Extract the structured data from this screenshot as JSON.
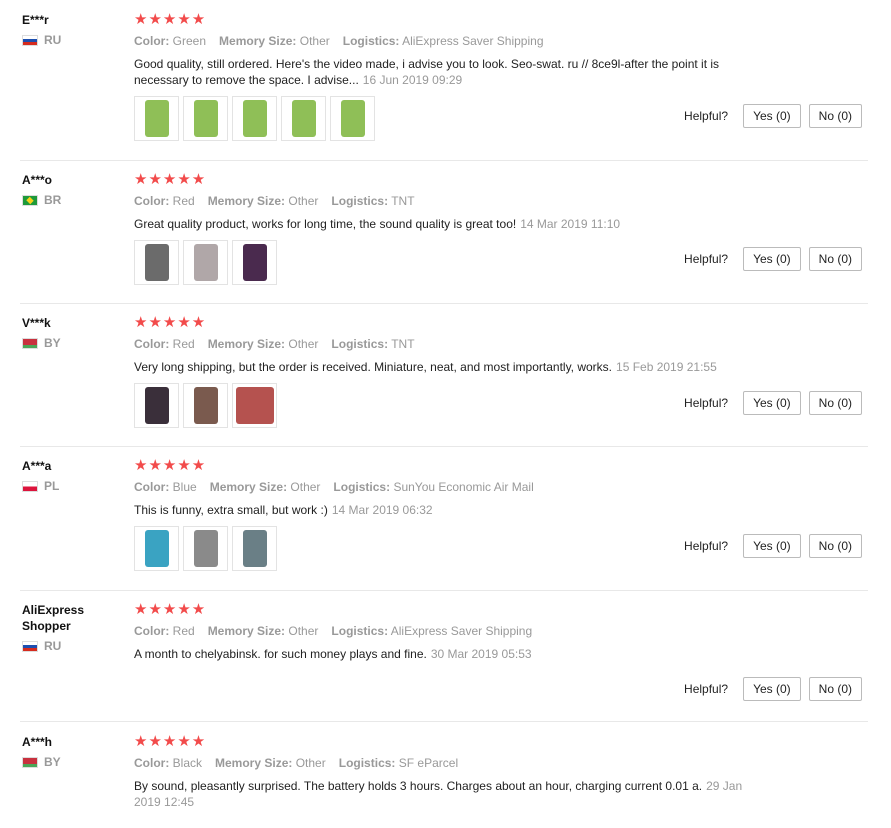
{
  "helpful_label": "Helpful?",
  "star_glyphs": "★★★★★",
  "labels": {
    "color": "Color:",
    "memory": "Memory Size:",
    "logistics": "Logistics:"
  },
  "reviews": [
    {
      "user": "E***r",
      "country": "RU",
      "flag": "ru",
      "rating": 5,
      "color": "Green",
      "memory": "Other",
      "logistics": "AliExpress Saver Shipping",
      "text": "Good quality, still ordered. Here's the video made, i advise you to look. Seo-swat. ru // 8ce9l-after the point it is necessary to remove the space. I advise...",
      "date": "16 Jun 2019 09:29",
      "yes": "Yes (0)",
      "no": "No (0)",
      "photos": [
        "#8fbf57",
        "#8fbf57",
        "#8fbf57",
        "#8fbf57",
        "#8fbf57"
      ]
    },
    {
      "user": "A***o",
      "country": "BR",
      "flag": "br",
      "rating": 5,
      "color": "Red",
      "memory": "Other",
      "logistics": "TNT",
      "text": "Great quality product, works for long time, the sound quality is great too!",
      "date": "14 Mar 2019 11:10",
      "yes": "Yes (0)",
      "no": "No (0)",
      "photos": [
        "#6b6b6b",
        "#b0a7a8",
        "#4a2a4e"
      ]
    },
    {
      "user": "V***k",
      "country": "BY",
      "flag": "by",
      "rating": 5,
      "color": "Red",
      "memory": "Other",
      "logistics": "TNT",
      "text": "Very long shipping, but the order is received. Miniature, neat, and most importantly, works.",
      "date": "15 Feb 2019 21:55",
      "yes": "Yes (0)",
      "no": "No (0)",
      "photos": [
        "#3a2f3a",
        "#7a5a4e",
        "#b5524f"
      ]
    },
    {
      "user": "A***a",
      "country": "PL",
      "flag": "pl",
      "rating": 5,
      "color": "Blue",
      "memory": "Other",
      "logistics": "SunYou Economic Air Mail",
      "text": "This is funny, extra small, but work :)",
      "date": "14 Mar 2019 06:32",
      "yes": "Yes (0)",
      "no": "No (0)",
      "photos": [
        "#3aa3c2",
        "#8a8a8a",
        "#6a7f86"
      ]
    },
    {
      "user": "AliExpress Shopper",
      "country": "RU",
      "flag": "ru",
      "rating": 5,
      "color": "Red",
      "memory": "Other",
      "logistics": "AliExpress Saver Shipping",
      "text": "A month to chelyabinsk. for such money plays and fine.",
      "date": "30 Mar 2019 05:53",
      "yes": "Yes (0)",
      "no": "No (0)",
      "photos": []
    },
    {
      "user": "A***h",
      "country": "BY",
      "flag": "by",
      "rating": 5,
      "color": "Black",
      "memory": "Other",
      "logistics": "SF eParcel",
      "text": "By sound, pleasantly surprised. The battery holds 3 hours. Charges about an hour, charging current 0.01 a.",
      "date": "29 Jan 2019 12:45",
      "yes": "Yes (0)",
      "no": "No (0)",
      "photos": []
    }
  ]
}
